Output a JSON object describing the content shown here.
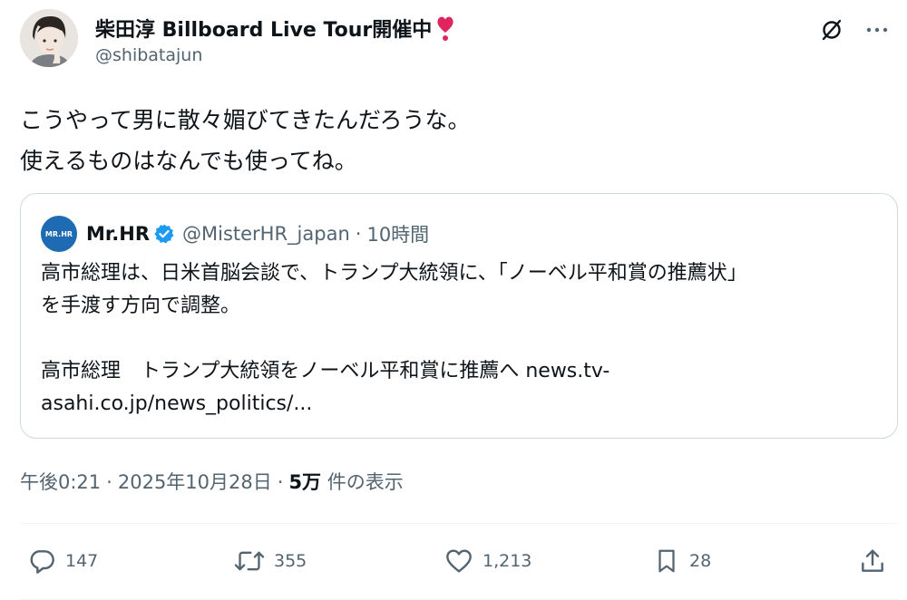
{
  "author": {
    "display_name": "柴田淳 Billboard Live Tour開催中",
    "name_emoji": "heart-exclamation-icon",
    "handle": "@shibatajun"
  },
  "tweet": {
    "lines": [
      "こうやって男に散々媚びてきたんだろうな。",
      "使えるものはなんでも使ってね。"
    ]
  },
  "quote": {
    "avatar_text": "MR.HR",
    "name": "Mr.HR",
    "verified": true,
    "handle": "@MisterHR_japan",
    "separator": "·",
    "time": "10時間",
    "lines": [
      "高市総理は、日米首脳会談で、トランプ大統領に、「ノーベル平和賞の推薦状」",
      "を手渡す方向で調整。",
      "",
      "高市総理　トランプ大統領をノーベル平和賞に推薦へ news.tv-",
      "asahi.co.jp/news_politics/..."
    ]
  },
  "meta": {
    "time": "午後0:21",
    "separator": "·",
    "date": "2025年10月28日",
    "views_count": "5万",
    "views_label": " 件の表示"
  },
  "actions": {
    "reply_count": "147",
    "retweet_count": "355",
    "like_count": "1,213",
    "bookmark_count": "28"
  },
  "colors": {
    "text": "#0f1419",
    "secondary": "#536471",
    "border": "#cfd9de",
    "verified": "#1d9bf0",
    "heart": "#e0245e"
  }
}
